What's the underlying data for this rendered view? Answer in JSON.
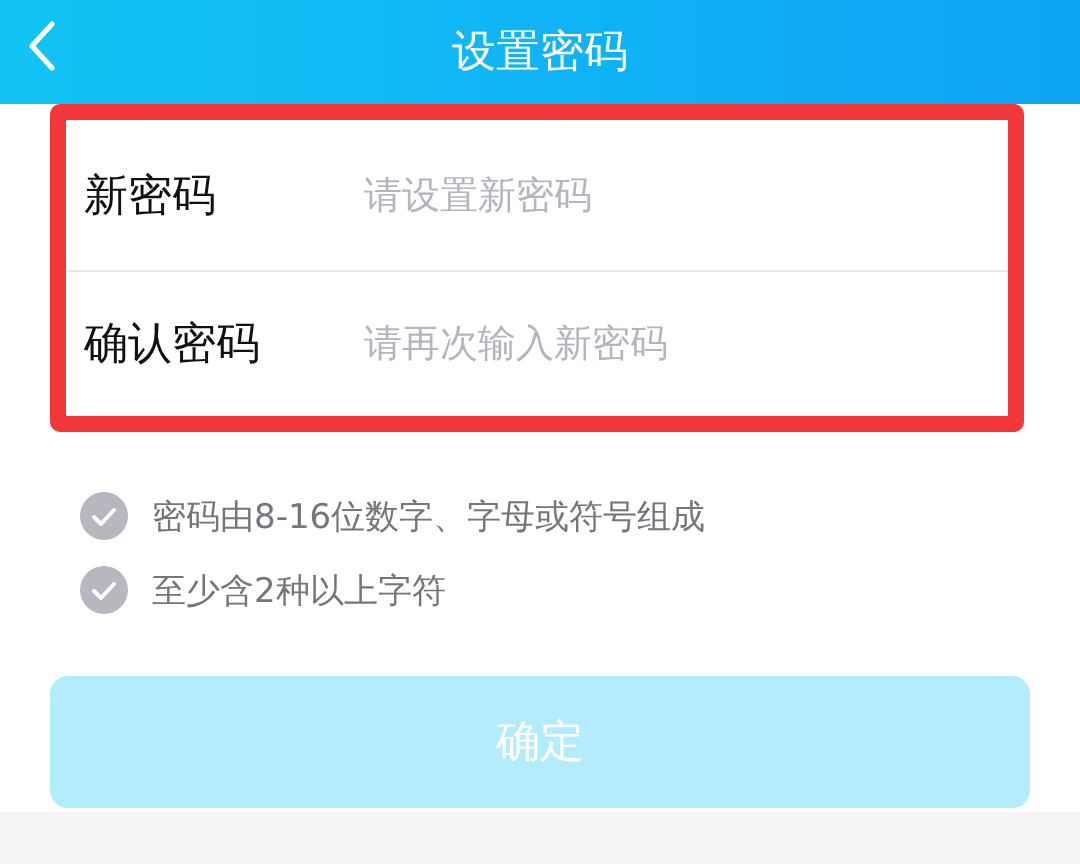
{
  "header": {
    "title": "设置密码"
  },
  "fields": [
    {
      "label": "新密码",
      "placeholder": "请设置新密码"
    },
    {
      "label": "确认密码",
      "placeholder": "请再次输入新密码"
    }
  ],
  "rules": [
    {
      "text": "密码由8-16位数字、字母或符号组成",
      "met": false
    },
    {
      "text": "至少含2种以上字符",
      "met": false
    }
  ],
  "confirm_button": {
    "label": "确定",
    "disabled": true
  }
}
